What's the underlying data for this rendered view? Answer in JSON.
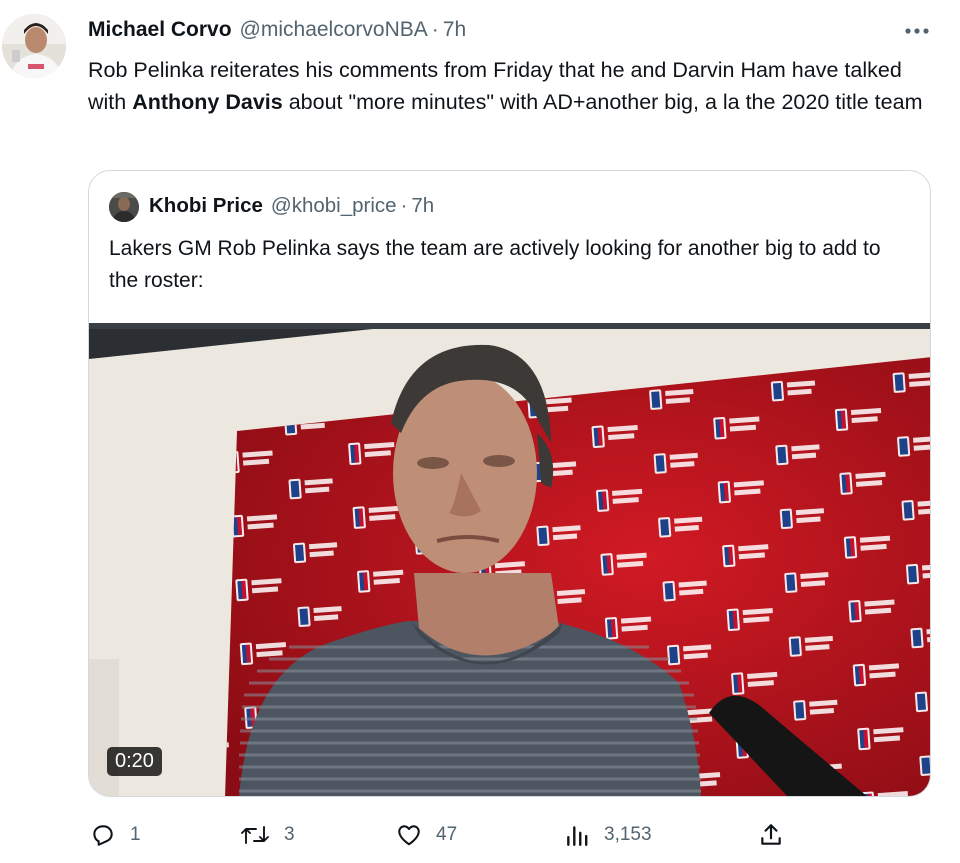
{
  "tweet": {
    "author_name": "Michael Corvo",
    "author_handle": "@michaelcorvoNBA",
    "separator": "·",
    "time": "7h",
    "text_part1": "Rob Pelinka reiterates his comments from Friday that he and Darvin Ham have talked with ",
    "text_bold": "Anthony Davis",
    "text_part2": " about \"more minutes\" with AD+another big, a la the 2020 title team",
    "more_icon": "more-horizontal-icon"
  },
  "quote": {
    "author_name": "Khobi Price",
    "author_handle": "@khobi_price",
    "separator": "·",
    "time": "7h",
    "text": "Lakers GM Rob Pelinka says the team are actively looking for another big to add to the roster:",
    "video_duration": "0:20"
  },
  "actions": {
    "reply_count": "1",
    "retweet_count": "3",
    "like_count": "47",
    "views_count": "3,153",
    "icons": [
      "reply-icon",
      "retweet-icon",
      "like-icon",
      "views-icon",
      "share-icon"
    ]
  },
  "colors": {
    "text": "#0f1419",
    "muted": "#536471",
    "border": "#cfd9de",
    "backdrop_red": "#b3121d"
  }
}
